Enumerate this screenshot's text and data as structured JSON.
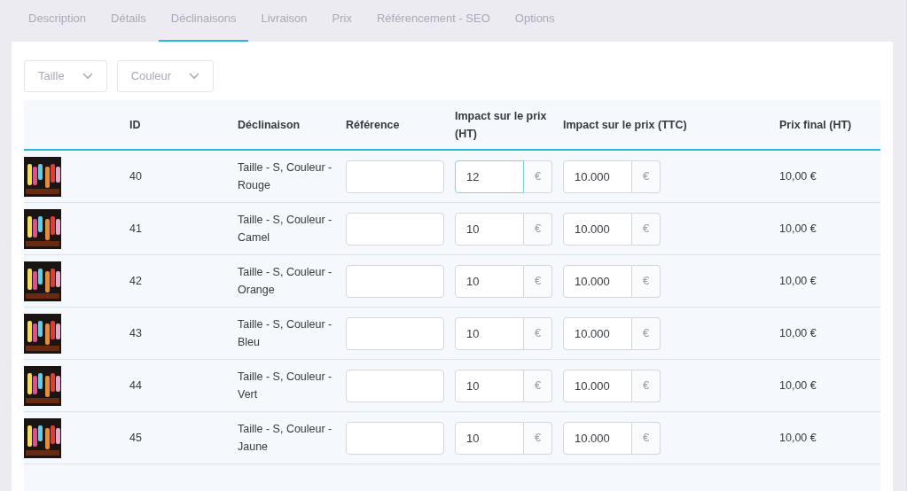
{
  "tabs": [
    {
      "label": "Description",
      "selected": false
    },
    {
      "label": "Détails",
      "selected": false
    },
    {
      "label": "Déclinaisons",
      "selected": true
    },
    {
      "label": "Livraison",
      "selected": false
    },
    {
      "label": "Prix",
      "selected": false
    },
    {
      "label": "Référencement - SEO",
      "selected": false
    },
    {
      "label": "Options",
      "selected": false
    }
  ],
  "filters": [
    {
      "label": "Taille"
    },
    {
      "label": "Couleur"
    }
  ],
  "table": {
    "columns": [
      "ID",
      "Déclinaison",
      "Référence",
      "Impact sur le prix (HT)",
      "Impact sur le prix (TTC)",
      "Prix final (HT)"
    ],
    "rows": [
      {
        "id": "40",
        "combination": "Taille - S, Couleur - Rouge",
        "reference": "",
        "impact_ht": "12",
        "impact_ht_focused": true,
        "currency_ht": "€",
        "impact_ttc": "10.000",
        "currency_ttc": "€",
        "final_price": "10,00 €"
      },
      {
        "id": "41",
        "combination": "Taille - S, Couleur - Camel",
        "reference": "",
        "impact_ht": "10",
        "impact_ht_focused": false,
        "currency_ht": "€",
        "impact_ttc": "10.000",
        "currency_ttc": "€",
        "final_price": "10,00 €"
      },
      {
        "id": "42",
        "combination": "Taille - S, Couleur - Orange",
        "reference": "",
        "impact_ht": "10",
        "impact_ht_focused": false,
        "currency_ht": "€",
        "impact_ttc": "10.000",
        "currency_ttc": "€",
        "final_price": "10,00 €"
      },
      {
        "id": "43",
        "combination": "Taille - S, Couleur - Bleu",
        "reference": "",
        "impact_ht": "10",
        "impact_ht_focused": false,
        "currency_ht": "€",
        "impact_ttc": "10.000",
        "currency_ttc": "€",
        "final_price": "10,00 €"
      },
      {
        "id": "44",
        "combination": "Taille - S, Couleur - Vert",
        "reference": "",
        "impact_ht": "10",
        "impact_ht_focused": false,
        "currency_ht": "€",
        "impact_ttc": "10.000",
        "currency_ttc": "€",
        "final_price": "10,00 €"
      },
      {
        "id": "45",
        "combination": "Taille - S, Couleur - Jaune",
        "reference": "",
        "impact_ht": "10",
        "impact_ht_focused": false,
        "currency_ht": "€",
        "impact_ttc": "10.000",
        "currency_ttc": "€",
        "final_price": "10,00 €"
      }
    ]
  }
}
